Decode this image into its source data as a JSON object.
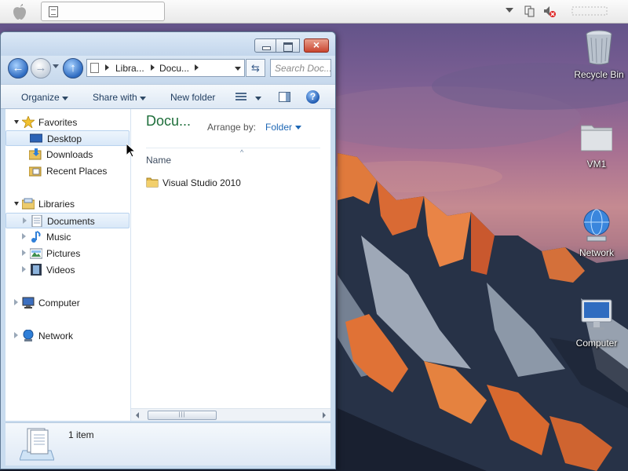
{
  "window": {
    "address": {
      "crumbs": [
        "Libra...",
        "Docu..."
      ]
    },
    "search": {
      "placeholder": "Search Doc..."
    },
    "toolbar": {
      "organize": "Organize",
      "share_with": "Share with",
      "new_folder": "New folder"
    },
    "nav": {
      "favorites": {
        "label": "Favorites",
        "items": [
          "Desktop",
          "Downloads",
          "Recent Places"
        ]
      },
      "libraries": {
        "label": "Libraries",
        "items": [
          "Documents",
          "Music",
          "Pictures",
          "Videos"
        ]
      },
      "computer": "Computer",
      "network": "Network"
    },
    "content": {
      "title": "Docu...",
      "arrange_label": "Arrange by:",
      "arrange_value": "Folder",
      "column_name": "Name",
      "items": [
        {
          "name": "Visual Studio 2010",
          "type": "folder"
        }
      ]
    },
    "details": {
      "count": "1 item"
    }
  },
  "desktop": {
    "icons": [
      {
        "label": "Recycle Bin",
        "icon": "recycle-bin-icon"
      },
      {
        "label": "VM1",
        "icon": "folder-icon"
      },
      {
        "label": "Network",
        "icon": "network-icon"
      },
      {
        "label": "Computer",
        "icon": "computer-icon"
      }
    ]
  },
  "menubar": {
    "tray": [
      "chevron-down-icon",
      "network-status-icon",
      "volume-muted-icon"
    ]
  }
}
